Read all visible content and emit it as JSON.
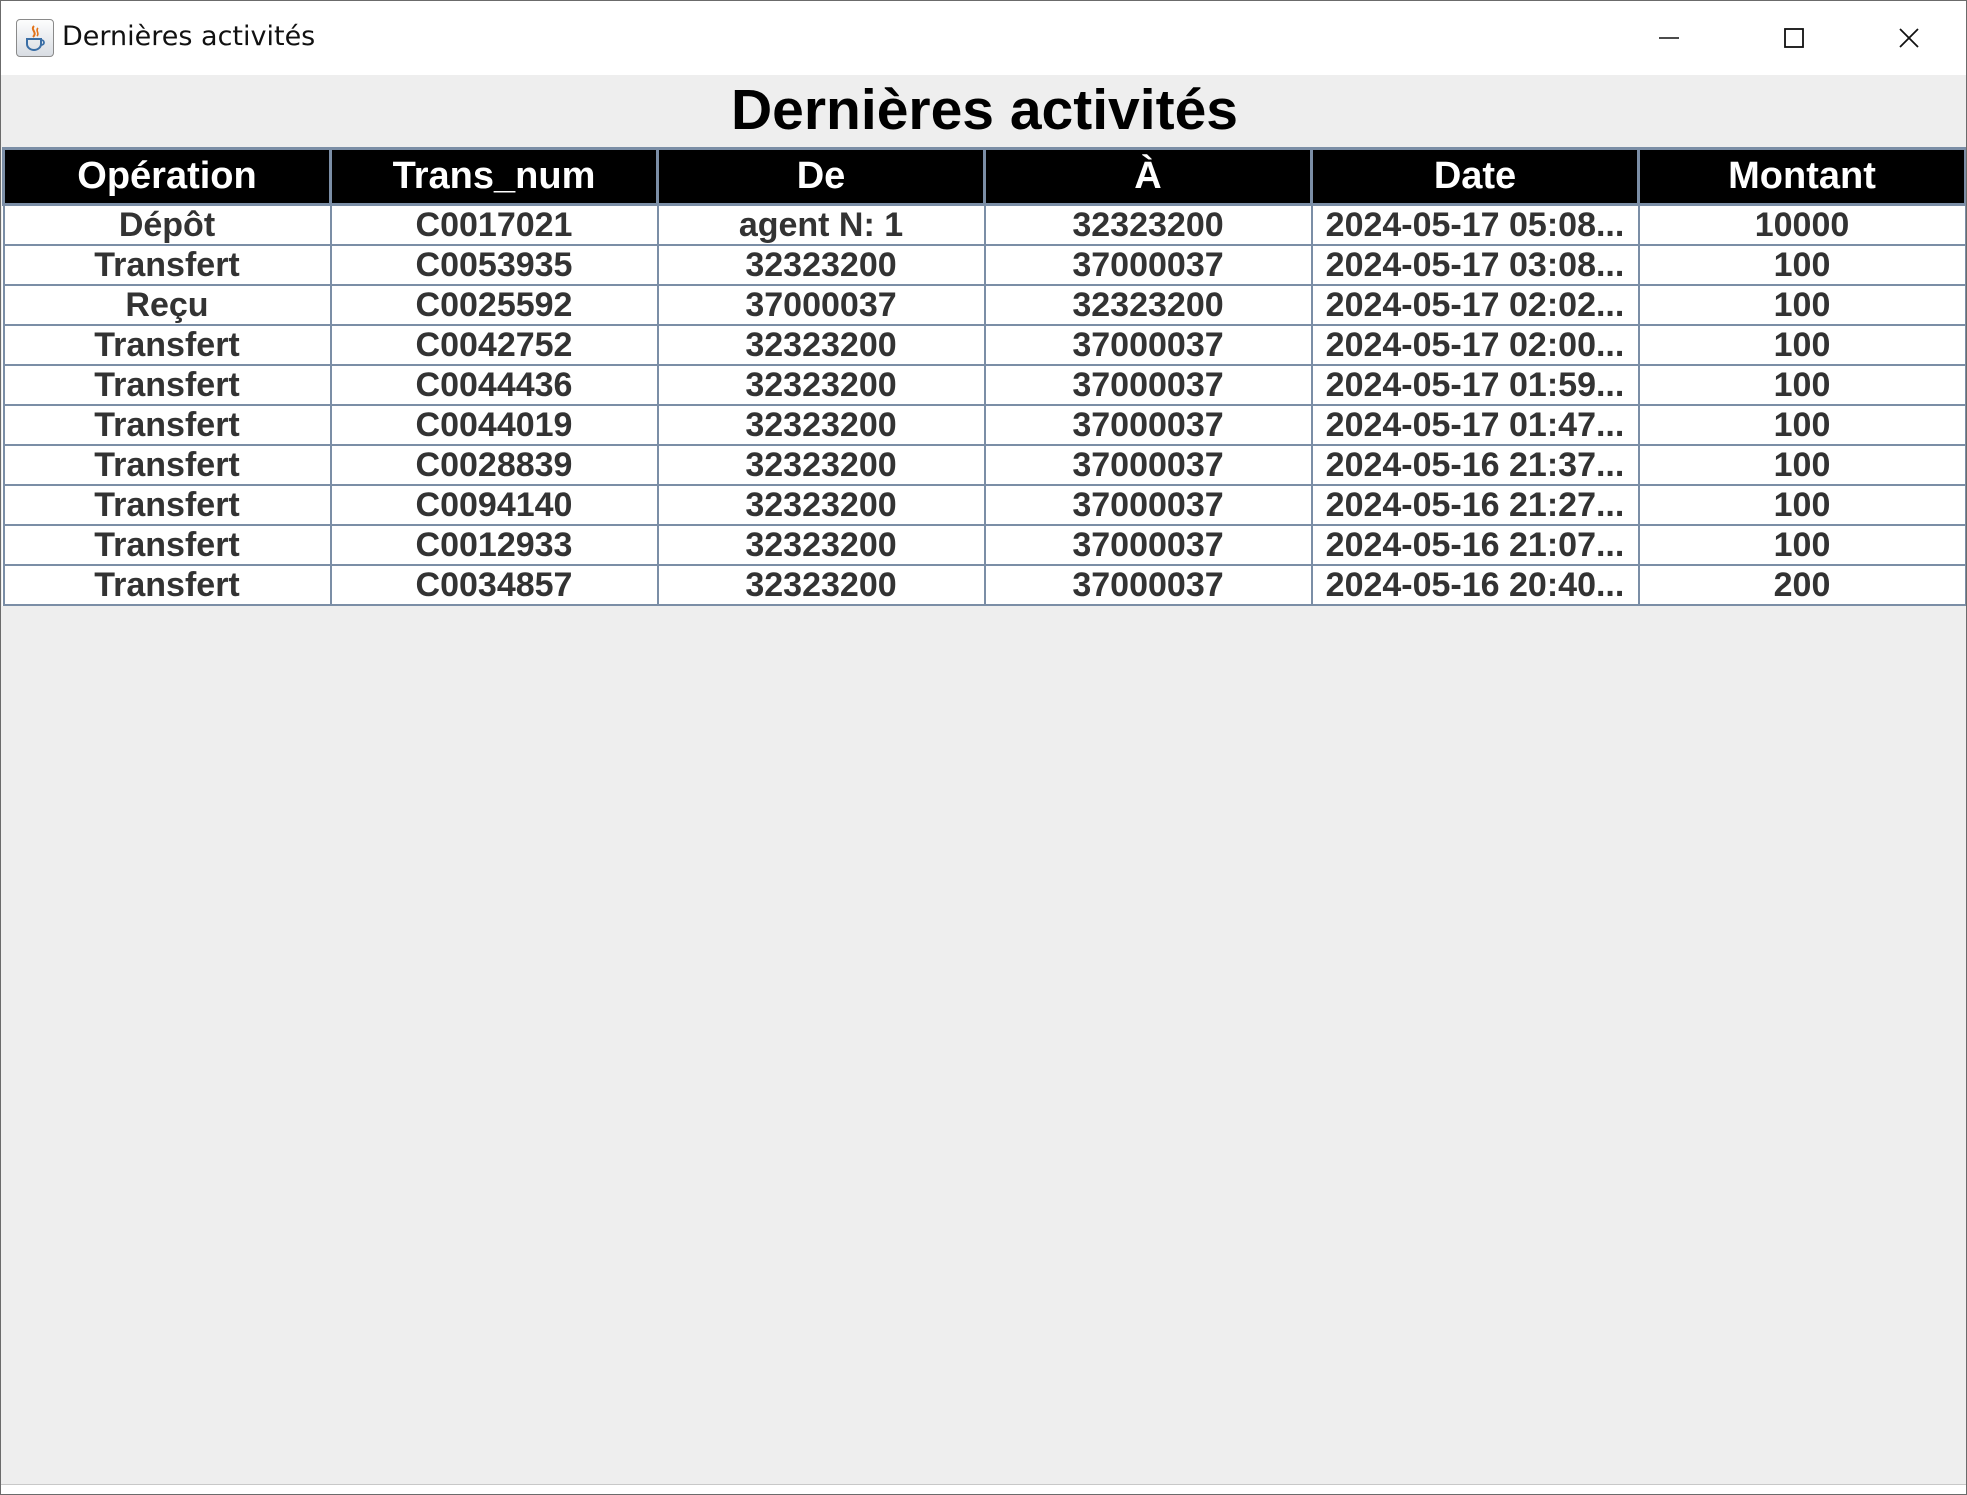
{
  "window": {
    "title": "Dernières activités",
    "app_icon": "java-cup-icon",
    "controls": [
      "minimize-icon",
      "maximize-icon",
      "close-icon"
    ]
  },
  "main": {
    "heading": "Dernières activités"
  },
  "table": {
    "columns": [
      "Opération",
      "Trans_num",
      "De",
      "À",
      "Date",
      "Montant"
    ],
    "rows": [
      [
        "Dépôt",
        "C0017021",
        "agent N: 1",
        "32323200",
        "2024-05-17 05:08...",
        "10000"
      ],
      [
        "Transfert",
        "C0053935",
        "32323200",
        "37000037",
        "2024-05-17 03:08...",
        "100"
      ],
      [
        "Reçu",
        "C0025592",
        "37000037",
        "32323200",
        "2024-05-17 02:02...",
        "100"
      ],
      [
        "Transfert",
        "C0042752",
        "32323200",
        "37000037",
        "2024-05-17 02:00...",
        "100"
      ],
      [
        "Transfert",
        "C0044436",
        "32323200",
        "37000037",
        "2024-05-17 01:59...",
        "100"
      ],
      [
        "Transfert",
        "C0044019",
        "32323200",
        "37000037",
        "2024-05-17 01:47...",
        "100"
      ],
      [
        "Transfert",
        "C0028839",
        "32323200",
        "37000037",
        "2024-05-16 21:37...",
        "100"
      ],
      [
        "Transfert",
        "C0094140",
        "32323200",
        "37000037",
        "2024-05-16 21:27...",
        "100"
      ],
      [
        "Transfert",
        "C0012933",
        "32323200",
        "37000037",
        "2024-05-16 21:07...",
        "100"
      ],
      [
        "Transfert",
        "C0034857",
        "32323200",
        "37000037",
        "2024-05-16 20:40...",
        "200"
      ]
    ]
  },
  "colors": {
    "header_bg": "#000000",
    "header_text": "#ffffff",
    "grid": "#7b8ea6",
    "cell_text": "#333333",
    "panel_bg": "#eeeeee"
  }
}
